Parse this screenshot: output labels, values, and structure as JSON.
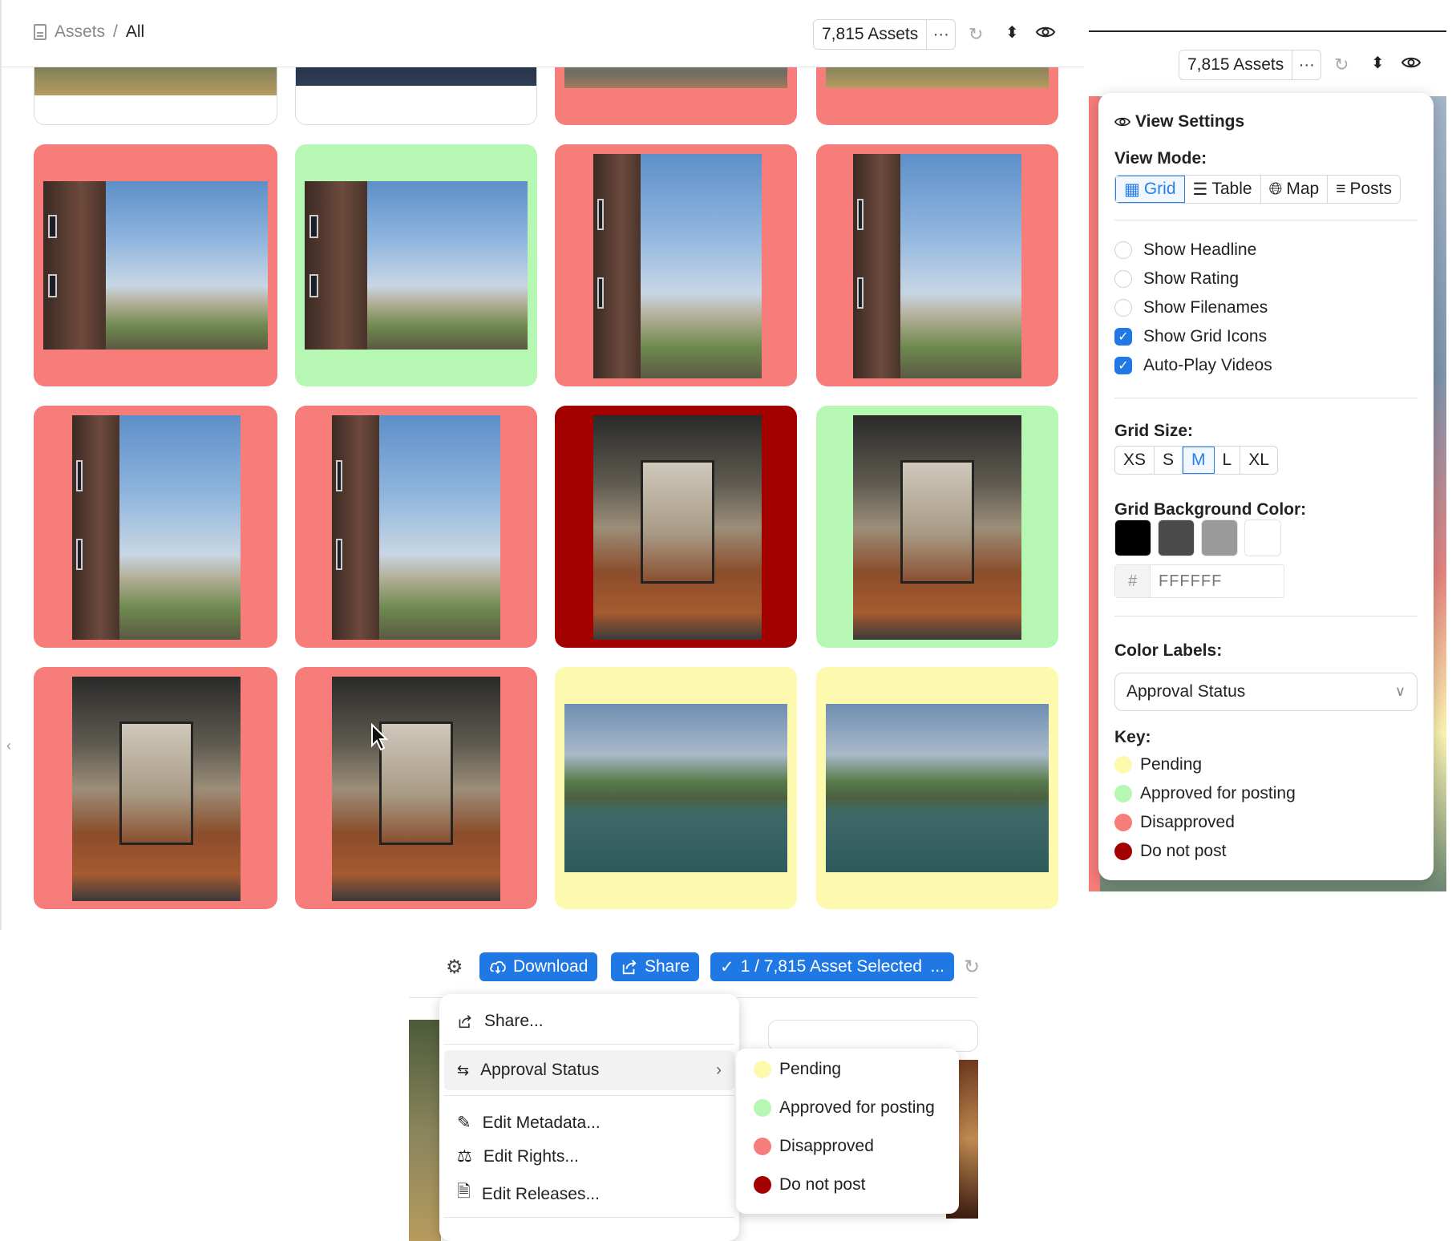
{
  "breadcrumb": {
    "root": "Assets",
    "separator": "/",
    "current": "All"
  },
  "toolbar": {
    "asset_count": "7,815 Assets",
    "more": "···"
  },
  "right_toolbar": {
    "asset_count": "7,815 Assets",
    "more": "···"
  },
  "view_settings": {
    "title": "View Settings",
    "view_mode_label": "View Mode:",
    "view_modes": [
      {
        "label": "Grid",
        "icon": "grid-icon",
        "active": true
      },
      {
        "label": "Table",
        "icon": "list-icon",
        "active": false
      },
      {
        "label": "Map",
        "icon": "globe-icon",
        "active": false
      },
      {
        "label": "Posts",
        "icon": "posts-icon",
        "active": false
      }
    ],
    "toggles": [
      {
        "label": "Show Headline",
        "checked": false
      },
      {
        "label": "Show Rating",
        "checked": false
      },
      {
        "label": "Show Filenames",
        "checked": false
      },
      {
        "label": "Show Grid Icons",
        "checked": true
      },
      {
        "label": "Auto-Play Videos",
        "checked": true
      }
    ],
    "grid_size_label": "Grid Size:",
    "grid_sizes": [
      {
        "label": "XS",
        "active": false
      },
      {
        "label": "S",
        "active": false
      },
      {
        "label": "M",
        "active": true
      },
      {
        "label": "L",
        "active": false
      },
      {
        "label": "XL",
        "active": false
      }
    ],
    "bg_color_label": "Grid Background Color:",
    "bg_swatches": [
      "#000000",
      "#4a4a4a",
      "#9a9a9a",
      "#ffffff"
    ],
    "hex_prefix": "#",
    "hex_value": "FFFFFF",
    "color_labels_label": "Color Labels:",
    "color_labels_value": "Approval Status",
    "key_label": "Key:",
    "key": [
      {
        "label": "Pending",
        "color": "#fdfab0"
      },
      {
        "label": "Approved for posting",
        "color": "#b6f7b4"
      },
      {
        "label": "Disapproved",
        "color": "#f77d7a"
      },
      {
        "label": "Do not post",
        "color": "#a30000"
      }
    ]
  },
  "grid": {
    "status_colors": {
      "pending": "#fdfab0",
      "approved": "#b6f7b4",
      "disapproved": "#f77d7a",
      "do_not_post": "#a30000",
      "none": "#ffffff"
    }
  },
  "bottom_toolbar": {
    "download_label": "Download",
    "share_label": "Share",
    "selected_label": "1 / 7,815  Asset Selected",
    "selected_more": "..."
  },
  "context_menu": {
    "items": [
      {
        "label": "Share...",
        "icon": "share-icon"
      },
      {
        "label": "Approval Status",
        "icon": "approval-icon",
        "has_submenu": true
      },
      {
        "label": "Edit Metadata...",
        "icon": "pencil-icon"
      },
      {
        "label": "Edit Rights...",
        "icon": "scale-icon"
      },
      {
        "label": "Edit Releases...",
        "icon": "release-doc-icon"
      }
    ],
    "submenu": [
      {
        "label": "Pending",
        "color": "#fdfab0"
      },
      {
        "label": "Approved for posting",
        "color": "#b6f7b4"
      },
      {
        "label": "Disapproved",
        "color": "#f77d7a"
      },
      {
        "label": "Do not post",
        "color": "#a30000"
      }
    ]
  }
}
